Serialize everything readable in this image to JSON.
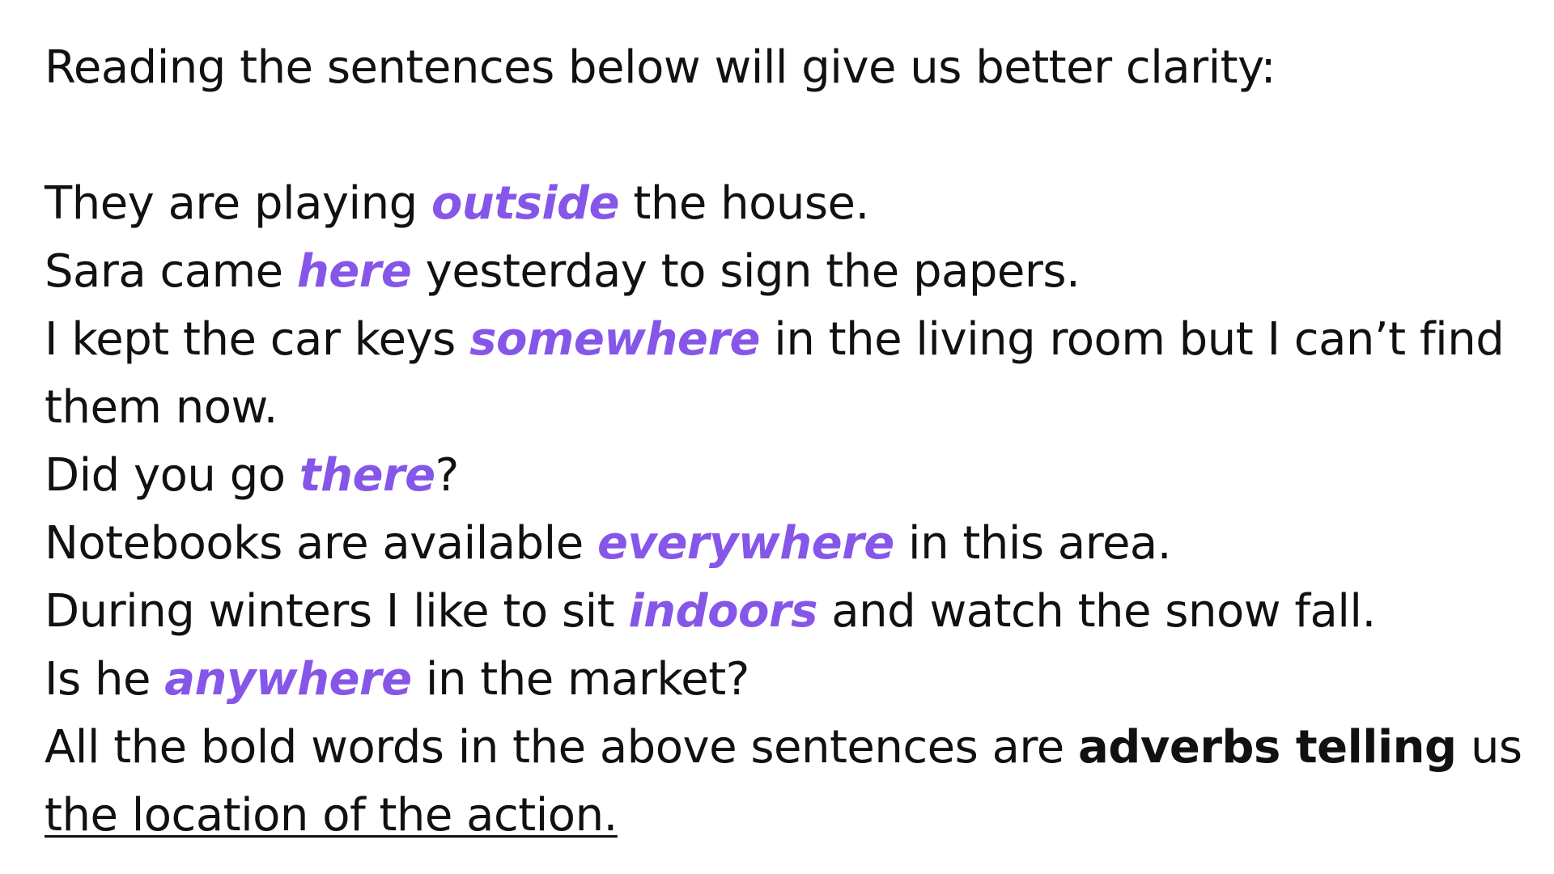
{
  "intro": "Reading the sentences below will give us better clarity:",
  "accent_color": "#8656e8",
  "sentences": [
    {
      "before": "They are playing ",
      "adverb": "outside",
      "after": " the house."
    },
    {
      "before": "Sara came ",
      "adverb": "here",
      "after": " yesterday to sign the papers."
    },
    {
      "before": "I kept the car keys ",
      "adverb": "somewhere",
      "after": " in the living room but I can’t find"
    },
    {
      "before": "them now.",
      "adverb": "",
      "after": ""
    },
    {
      "before": "Did you go ",
      "adverb": "there",
      "after": "?"
    },
    {
      "before": "Notebooks are available ",
      "adverb": "everywhere",
      "after": " in this area."
    },
    {
      "before": "During winters I like to sit ",
      "adverb": "indoors",
      "after": " and watch the snow fall."
    },
    {
      "before": "Is he ",
      "adverb": "anywhere",
      "after": " in the market?"
    }
  ],
  "conclusion": {
    "before": "All the bold words in the above sentences are ",
    "bold": "adverbs telling",
    "after": " us",
    "underlined": "the location of the action."
  }
}
